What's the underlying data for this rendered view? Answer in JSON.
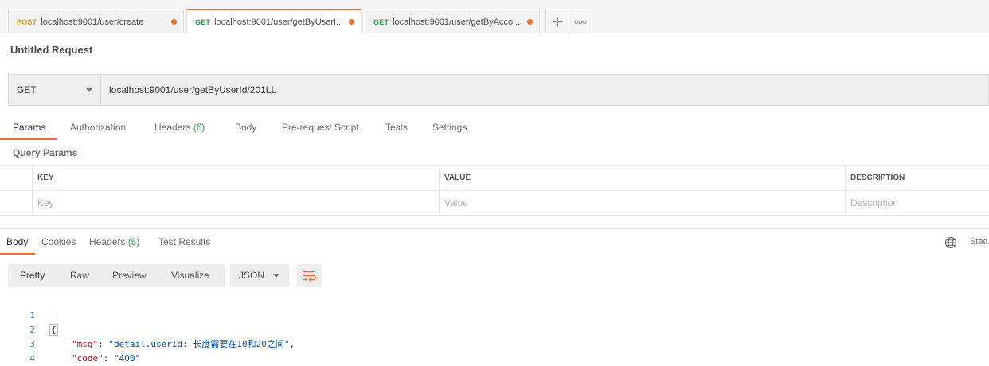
{
  "tabs": [
    {
      "method": "POST",
      "url": "localhost:9001/user/create",
      "unsaved": true
    },
    {
      "method": "GET",
      "url": "localhost:9001/user/getByUserI...",
      "unsaved": true,
      "active": true
    },
    {
      "method": "GET",
      "url": "localhost:9001/user/getByAcco...",
      "unsaved": true
    }
  ],
  "new_tab_icon": "plus-icon",
  "more_tabs_icon": "ellipsis-icon",
  "request_title": "Untitled Request",
  "request": {
    "method": "GET",
    "url": "localhost:9001/user/getByUserId/201LL"
  },
  "request_tabs": {
    "params": "Params",
    "authorization": "Authorization",
    "headers": "Headers",
    "headers_count": "(6)",
    "body": "Body",
    "pre_request_script": "Pre-request Script",
    "tests": "Tests",
    "settings": "Settings"
  },
  "query_params": {
    "title": "Query Params",
    "columns": [
      "KEY",
      "VALUE",
      "DESCRIPTION"
    ],
    "placeholders": [
      "Key",
      "Value",
      "Description"
    ]
  },
  "response_tabs": {
    "body": "Body",
    "cookies": "Cookies",
    "headers": "Headers",
    "headers_count": "(5)",
    "test_results": "Test Results"
  },
  "status_label": "Statu",
  "view_modes": [
    "Pretty",
    "Raw",
    "Preview",
    "Visualize"
  ],
  "format": "JSON",
  "wrap_icon": "wrap-lines-icon",
  "response_code": [
    {
      "line": "1",
      "text": "{"
    },
    {
      "line": "2",
      "key": "\"msg\"",
      "value": "\"detail.userId: 长度需要在10和20之间\"",
      "trail": ","
    },
    {
      "line": "3",
      "key": "\"code\"",
      "value": "\"400\"",
      "trail": ""
    },
    {
      "line": "4",
      "text": "}"
    }
  ],
  "colors": {
    "accent": "#f26b3a",
    "get": "#2e9d46",
    "post": "#d9a400",
    "unsaved_dot": "#ef7135"
  }
}
